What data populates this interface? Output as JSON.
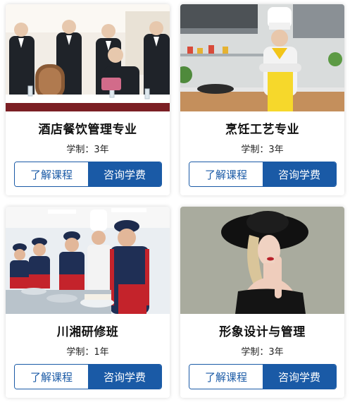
{
  "colors": {
    "accent": "#1a5aa6"
  },
  "cards": [
    {
      "title": "酒店餐饮管理专业",
      "duration": "学制：3年",
      "btn_learn": "了解课程",
      "btn_consult": "咨询学费"
    },
    {
      "title": "烹饪工艺专业",
      "duration": "学制：3年",
      "btn_learn": "了解课程",
      "btn_consult": "咨询学费"
    },
    {
      "title": "川湘研修班",
      "duration": "学制：1年",
      "btn_learn": "了解课程",
      "btn_consult": "咨询学费"
    },
    {
      "title": "形象设计与管理",
      "duration": "学制：3年",
      "btn_learn": "了解课程",
      "btn_consult": "咨询学费"
    }
  ]
}
